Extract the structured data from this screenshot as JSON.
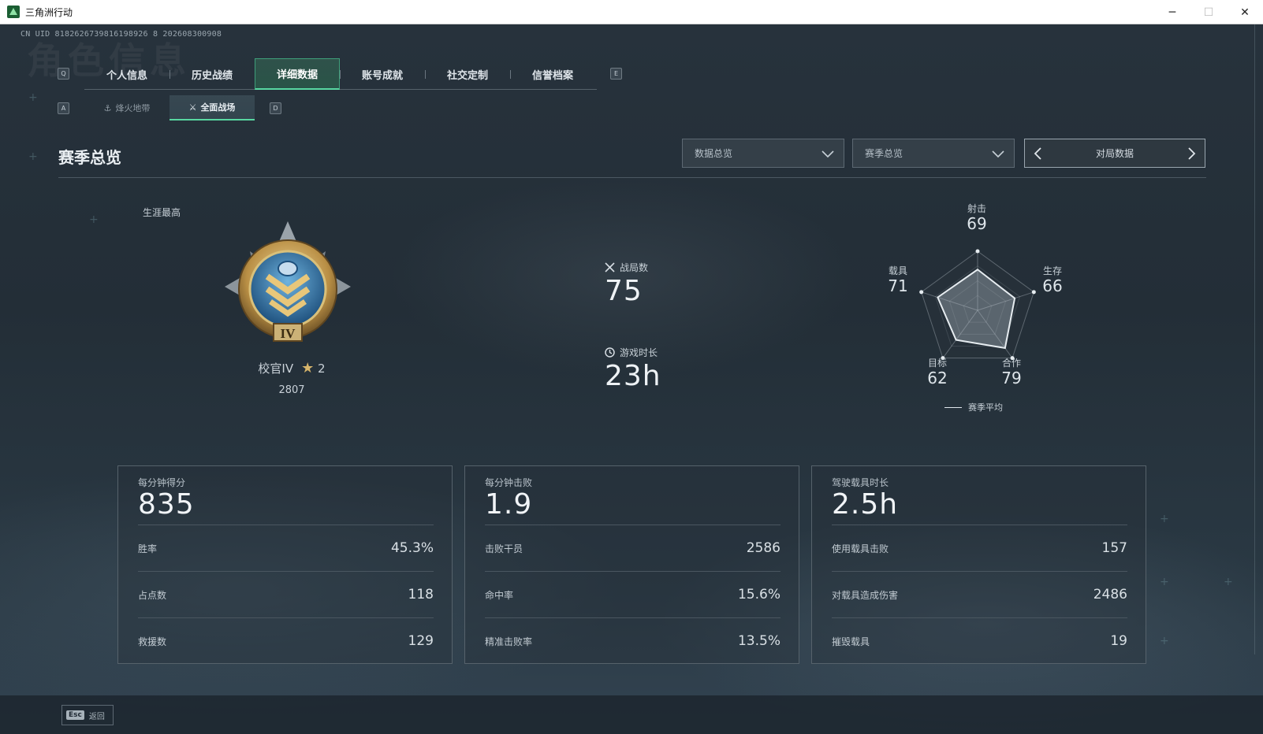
{
  "window": {
    "title": "三角洲行动",
    "controls": {
      "minimize": "─",
      "maximize": "☐",
      "close": "✕"
    }
  },
  "header": {
    "uid": "CN UID 8182626739816198926 8 202608300908",
    "watermark": "角色信息"
  },
  "keyhints": {
    "tabs_left": "Q",
    "tabs_right": "E",
    "sub_left": "A",
    "sub_right": "D"
  },
  "tabs": [
    {
      "label": "个人信息",
      "active": false
    },
    {
      "label": "历史战绩",
      "active": false
    },
    {
      "label": "详细数据",
      "active": true
    },
    {
      "label": "账号成就",
      "active": false
    },
    {
      "label": "社交定制",
      "active": false
    },
    {
      "label": "信誉档案",
      "active": false
    }
  ],
  "subtabs": [
    {
      "label": "烽火地带",
      "icon": "⚓",
      "active": false
    },
    {
      "label": "全面战场",
      "icon": "⚔",
      "active": true
    }
  ],
  "section": {
    "title": "赛季总览",
    "dropdown_data": "数据总览",
    "dropdown_season": "赛季总览",
    "pager_label": "对局数据"
  },
  "rank": {
    "career_label": "生涯最高",
    "name": "校官IV",
    "stars": "2",
    "score": "2807",
    "medal_numeral": "IV"
  },
  "center_stats": {
    "matches_label": "战局数",
    "matches_value": "75",
    "playtime_label": "游戏时长",
    "playtime_value": "23h"
  },
  "radar": {
    "axes": [
      {
        "label": "射击",
        "value": "69"
      },
      {
        "label": "生存",
        "value": "66"
      },
      {
        "label": "合作",
        "value": "79"
      },
      {
        "label": "目标",
        "value": "62"
      },
      {
        "label": "载具",
        "value": "71"
      }
    ],
    "legend": "赛季平均",
    "max": 100
  },
  "cards": [
    {
      "head_label": "每分钟得分",
      "head_value": "835",
      "rows": [
        {
          "label": "胜率",
          "value": "45.3%"
        },
        {
          "label": "占点数",
          "value": "118"
        },
        {
          "label": "救援数",
          "value": "129"
        }
      ]
    },
    {
      "head_label": "每分钟击败",
      "head_value": "1.9",
      "rows": [
        {
          "label": "击败干员",
          "value": "2586"
        },
        {
          "label": "命中率",
          "value": "15.6%"
        },
        {
          "label": "精准击败率",
          "value": "13.5%"
        }
      ]
    },
    {
      "head_label": "驾驶载具时长",
      "head_value": "2.5h",
      "rows": [
        {
          "label": "使用载具击败",
          "value": "157"
        },
        {
          "label": "对载具造成伤害",
          "value": "2486"
        },
        {
          "label": "摧毁载具",
          "value": "19"
        }
      ]
    }
  ],
  "footer": {
    "esc_key": "Esc",
    "back_label": "返回"
  },
  "colors": {
    "accent": "#58d7a1",
    "gold": "#d7b56b",
    "background": "#1f2933"
  }
}
